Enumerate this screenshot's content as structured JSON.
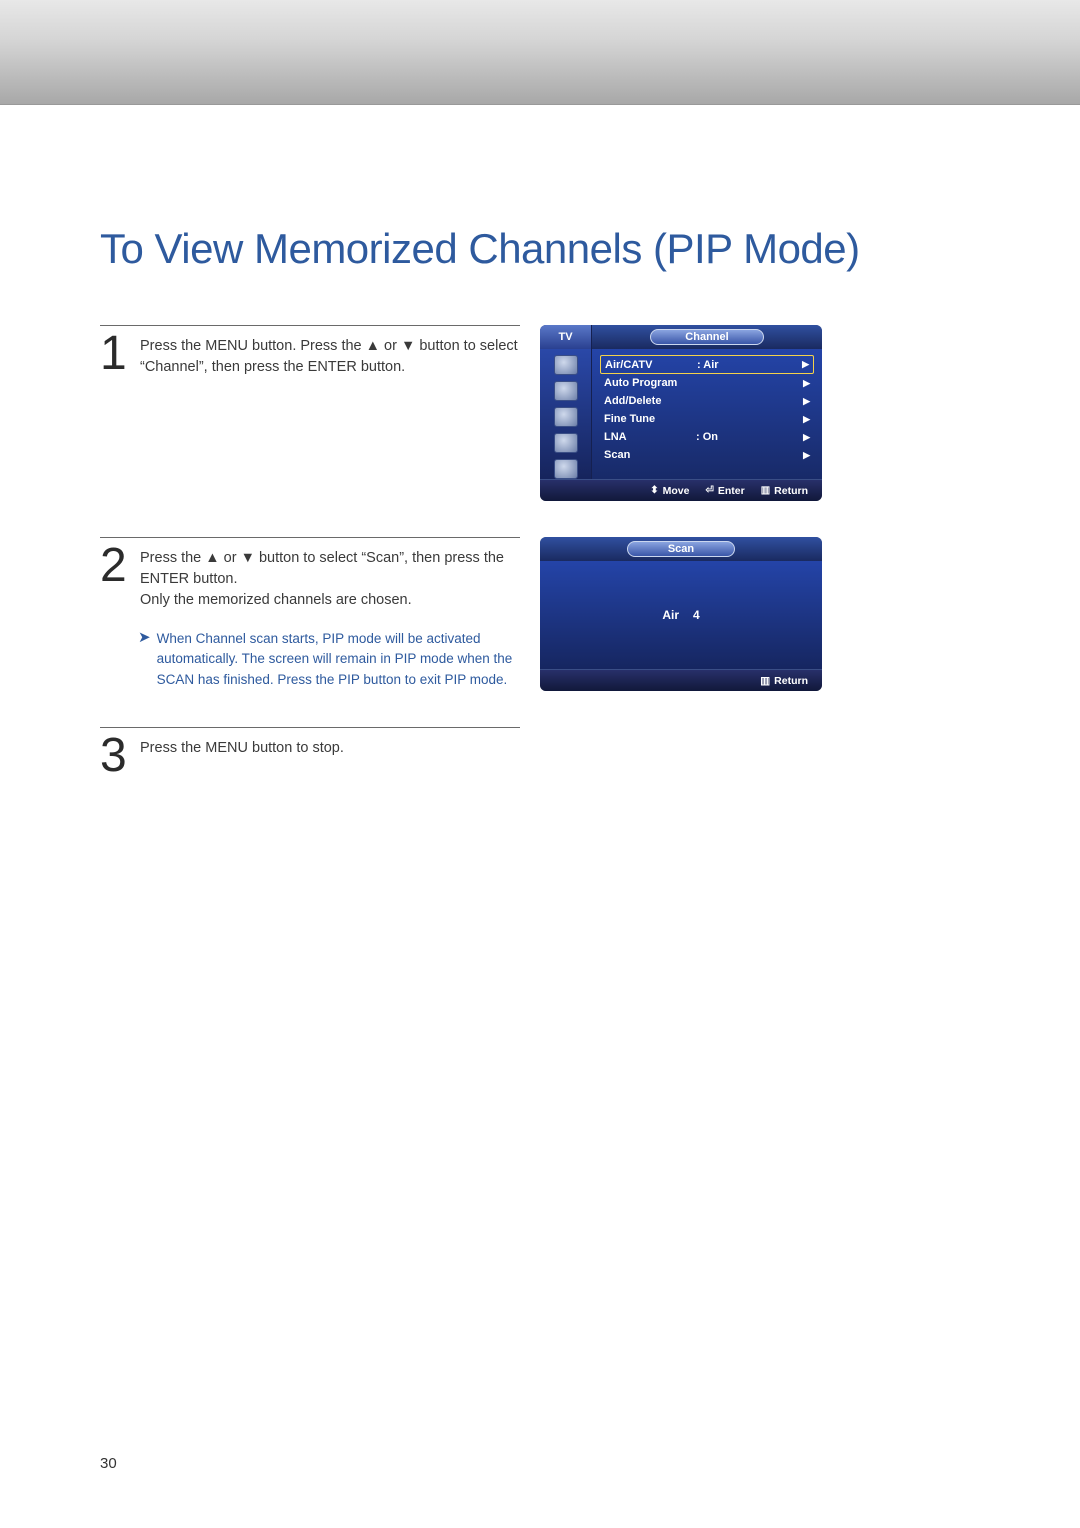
{
  "page": {
    "title": "To View Memorized Channels (PIP Mode)",
    "number": "30"
  },
  "steps": {
    "s1": {
      "num": "1",
      "text": "Press the MENU button. Press the ▲ or ▼ button to select “Channel”, then press the ENTER button."
    },
    "s2": {
      "num": "2",
      "text_a": "Press the ▲ or ▼ button to select “Scan”, then press the ENTER button.",
      "text_b": "Only the memorized channels are chosen.",
      "note": "When Channel scan starts, PIP mode will be activated automatically. The screen will remain in PIP mode when the SCAN has finished. Press the PIP button to exit PIP mode."
    },
    "s3": {
      "num": "3",
      "text": "Press the MENU button to stop."
    }
  },
  "osd1": {
    "tv": "TV",
    "title": "Channel",
    "items": [
      {
        "label": "Air/CATV",
        "value": ":   Air",
        "selected": true
      },
      {
        "label": "Auto Program",
        "value": "",
        "selected": false
      },
      {
        "label": "Add/Delete",
        "value": "",
        "selected": false
      },
      {
        "label": "Fine Tune",
        "value": "",
        "selected": false
      },
      {
        "label": "LNA",
        "value": ":   On",
        "selected": false
      },
      {
        "label": "Scan",
        "value": "",
        "selected": false
      }
    ],
    "foot": {
      "move": "Move",
      "enter": "Enter",
      "return": "Return"
    }
  },
  "osd2": {
    "title": "Scan",
    "source": "Air",
    "channel": "4",
    "foot_return": "Return"
  }
}
